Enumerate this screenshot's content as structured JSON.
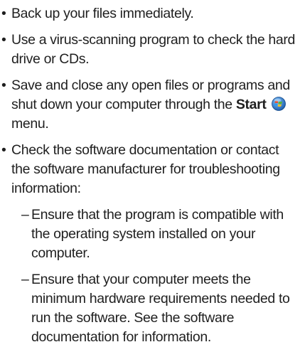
{
  "bullet_glyph": "•",
  "dash_glyph": "–",
  "items": [
    {
      "text": "Back up your files immediately."
    },
    {
      "text": "Use a virus-scanning program to check the hard drive or CDs."
    },
    {
      "pre": "Save and close any open files or programs and shut down your computer through the",
      "strong": "Start",
      "icon": "windows-start-orb-icon",
      "post": "menu."
    },
    {
      "text": "Check the software documentation or contact the software manufacturer for troubleshooting information:",
      "subitems": [
        {
          "text": "Ensure that the program is compatible with the operating system installed on your computer."
        },
        {
          "text": "Ensure that your computer meets the minimum hardware requirements needed to run the software. See the software documentation for information."
        }
      ]
    }
  ],
  "colors": {
    "text": "#1f1f1f",
    "orb_blue": "#2a78c8",
    "orb_red": "#e84a2a",
    "orb_green": "#5cb82e",
    "orb_yellow": "#f5c223"
  }
}
